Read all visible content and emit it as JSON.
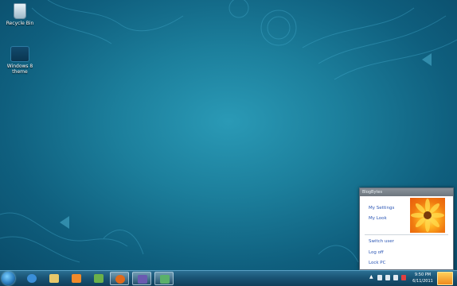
{
  "desktop": {
    "icons": [
      {
        "label": "Recycle Bin",
        "icon": "recycle-bin-icon"
      },
      {
        "label": "Windows 8 theme",
        "icon": "folder-theme-icon"
      }
    ],
    "colors": {
      "wallpaper": "#1c7f9c",
      "taskbar": "#1a5475"
    }
  },
  "popup": {
    "title": "BlogBytes",
    "links": {
      "my_settings": "My Settings",
      "my_look": "My Look",
      "switch_user": "Switch user",
      "log_off": "Log off",
      "lock_pc": "Lock PC"
    },
    "avatar": "gerbera-flower-picture",
    "link_color": "#2a55b4"
  },
  "taskbar": {
    "start": "windows-orb-icon",
    "pinned": [
      {
        "name": "internet-explorer-icon"
      },
      {
        "name": "file-explorer-icon"
      },
      {
        "name": "media-player-icon"
      },
      {
        "name": "paint-icon"
      },
      {
        "name": "firefox-icon"
      },
      {
        "name": "remote-desktop-icon"
      },
      {
        "name": "network-app-icon"
      }
    ],
    "clock": {
      "time": "9:50 PM",
      "date": "6/11/2011"
    }
  }
}
